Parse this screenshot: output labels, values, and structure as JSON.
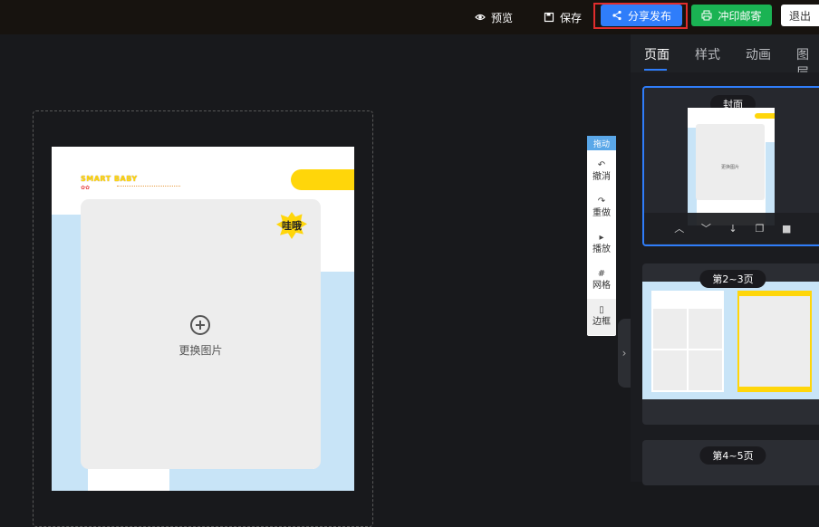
{
  "topbar": {
    "preview_label": "预览",
    "save_label": "保存",
    "share_label": "分享发布",
    "print_label": "冲印邮寄",
    "exit_label": "退出",
    "share_color": "#2f7dfa",
    "print_color": "#1ab353",
    "highlight_color": "#e02d2d"
  },
  "canvas": {
    "brand_title": "SMART BABY",
    "replace_photo_label": "更换图片",
    "sticker_text": "哇哦"
  },
  "toolrail": {
    "drag_label": "拖动",
    "tools": [
      {
        "icon": "undo-icon",
        "glyph": "↶",
        "label": "撤消"
      },
      {
        "icon": "redo-icon",
        "glyph": "↷",
        "label": "重做"
      },
      {
        "icon": "play-icon",
        "glyph": "▸",
        "label": "播放"
      },
      {
        "icon": "grid-icon",
        "glyph": "#",
        "label": "网格"
      },
      {
        "icon": "frame-icon",
        "glyph": "▯",
        "label": "边框"
      }
    ]
  },
  "panel": {
    "tabs": [
      "页面",
      "样式",
      "动画",
      "图层"
    ],
    "active_tab": "页面",
    "cards": [
      {
        "label": "封面",
        "selected": true
      },
      {
        "label": "第2~3页",
        "selected": false
      },
      {
        "label": "第4~5页",
        "selected": false
      }
    ],
    "thumb_photo_label": "更换图片"
  }
}
